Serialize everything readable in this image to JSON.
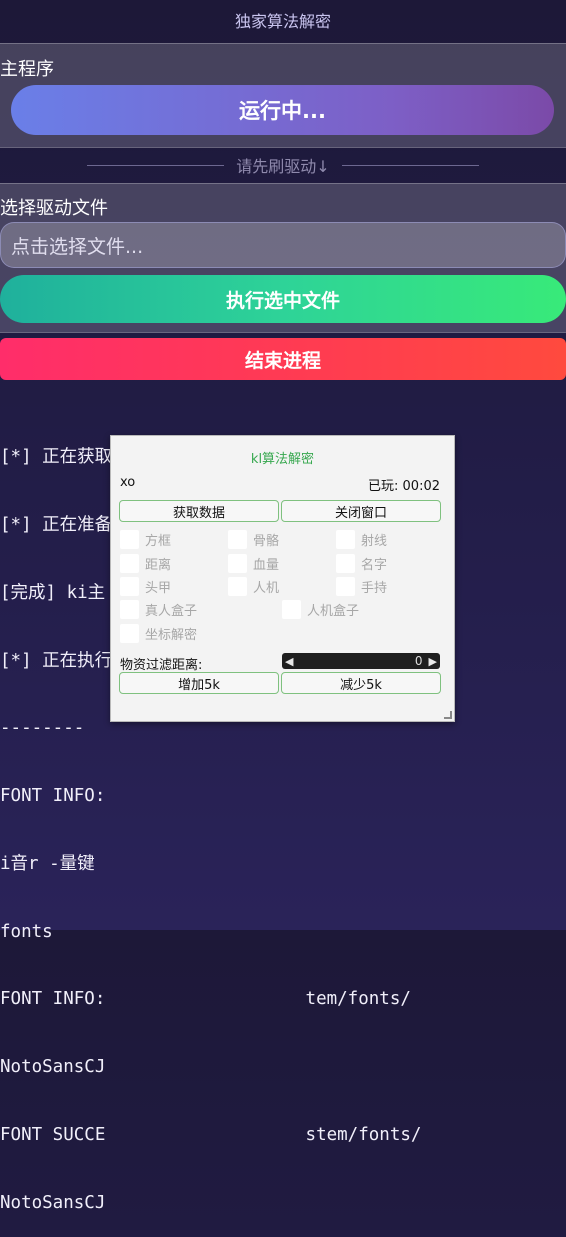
{
  "app": {
    "title": "独家算法解密"
  },
  "main_section": {
    "label": "主程序",
    "running_button": "运行中..."
  },
  "divider": {
    "text": "请先刷驱动↓"
  },
  "driver_section": {
    "label": "选择驱动文件",
    "file_input_text": "点击选择文件...",
    "execute_button": "执行选中文件"
  },
  "end_button": "结束进程",
  "console": {
    "lines": [
      "[*] 正在获取 ROOT 权限...",
      "[*] 正在准备 ki主程序",
      "[完成] ki主",
      "[*] 正在执行",
      "--------",
      "FONT INFO:",
      "i音r -量键",
      "fonts",
      "FONT INFO:                   tem/fonts/",
      "NotoSansCJ",
      "FONT SUCCE                   stem/fonts/",
      "NotoSansCJ"
    ]
  },
  "dialog": {
    "title": "kl算法解密",
    "user": "xo",
    "timer": "已玩: 00:02",
    "fetch_button": "获取数据",
    "close_button": "关闭窗口",
    "checkboxes": {
      "box": "方框",
      "bone": "骨骼",
      "ray": "射线",
      "distance": "距离",
      "health": "血量",
      "name": "名字",
      "helmet": "头甲",
      "bot": "人机",
      "weapon": "手持",
      "real_box": "真人盒子",
      "bot_box": "人机盒子",
      "coord_decrypt": "坐标解密"
    },
    "filter_label": "物资过滤距离:",
    "filter_value": "0",
    "increase_button": "增加5k",
    "decrease_button": "减少5k"
  }
}
